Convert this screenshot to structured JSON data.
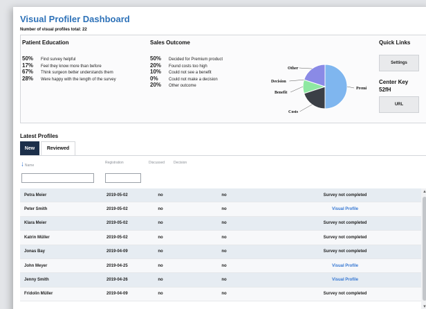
{
  "header": {
    "title": "Visual Profiler Dashboard",
    "subtitle": "Number of visual profiles total: 22"
  },
  "patient_education": {
    "heading": "Patient Education",
    "items": [
      {
        "pct": "50%",
        "text": "Find survey helpful"
      },
      {
        "pct": "17%",
        "text": "Feel they know more than before"
      },
      {
        "pct": "67%",
        "text": "Think surgeon better understands them"
      },
      {
        "pct": "28%",
        "text": "Were happy with the length of the survey"
      }
    ]
  },
  "sales_outcome": {
    "heading": "Sales Outcome",
    "items": [
      {
        "pct": "50%",
        "text": "Decided for Premium product"
      },
      {
        "pct": "20%",
        "text": "Found costs too high"
      },
      {
        "pct": "10%",
        "text": "Could not see a benefit"
      },
      {
        "pct": "0%",
        "text": "Could not make a decision"
      },
      {
        "pct": "20%",
        "text": "Other outcome"
      }
    ],
    "pie": {
      "labels": [
        "Premium",
        "Costs",
        "Benefit",
        "Decision",
        "Other"
      ],
      "values": [
        50,
        20,
        10,
        0,
        20
      ],
      "colors": [
        "#7fb6ef",
        "#3b3f46",
        "#8fe8a2",
        "#4a4f57",
        "#8a8ae6"
      ]
    }
  },
  "quick_links": {
    "heading": "Quick Links",
    "settings_label": "Settings",
    "center_key_label": "Center Key",
    "center_key_value": "52fH",
    "url_label": "URL"
  },
  "latest_profiles": {
    "heading": "Latest Profiles",
    "tabs": [
      {
        "label": "New",
        "active": true
      },
      {
        "label": "Reviewed",
        "active": false
      }
    ],
    "columns": {
      "name": "Name",
      "registration": "Registration",
      "discussed": "Discussed",
      "decision": "Decision"
    },
    "rows": [
      {
        "name": "Petra Meier",
        "registration": "2019-05-02",
        "discussed": "no",
        "decision": "no",
        "status": "Survey not completed",
        "link": false
      },
      {
        "name": "Peter Smith",
        "registration": "2019-05-02",
        "discussed": "no",
        "decision": "no",
        "status": "Visual Profile",
        "link": true
      },
      {
        "name": "Klara Meier",
        "registration": "2019-05-02",
        "discussed": "no",
        "decision": "no",
        "status": "Survey not completed",
        "link": false
      },
      {
        "name": "Katrin Müller",
        "registration": "2019-05-02",
        "discussed": "no",
        "decision": "no",
        "status": "Survey not completed",
        "link": false
      },
      {
        "name": "Jonas Bay",
        "registration": "2019-04-09",
        "discussed": "no",
        "decision": "no",
        "status": "Survey not completed",
        "link": false
      },
      {
        "name": "John Meyer",
        "registration": "2019-04-25",
        "discussed": "no",
        "decision": "no",
        "status": "Visual Profile",
        "link": true
      },
      {
        "name": "Jenny Smith",
        "registration": "2019-04-26",
        "discussed": "no",
        "decision": "no",
        "status": "Visual Profile",
        "link": true
      },
      {
        "name": "Fridolin Müller",
        "registration": "2019-04-09",
        "discussed": "no",
        "decision": "no",
        "status": "Survey not completed",
        "link": false
      }
    ]
  },
  "icons": {
    "sort": "sort-arrow-down-icon",
    "scroll_up": "scroll-up-icon",
    "scroll_down": "scroll-down-icon"
  }
}
